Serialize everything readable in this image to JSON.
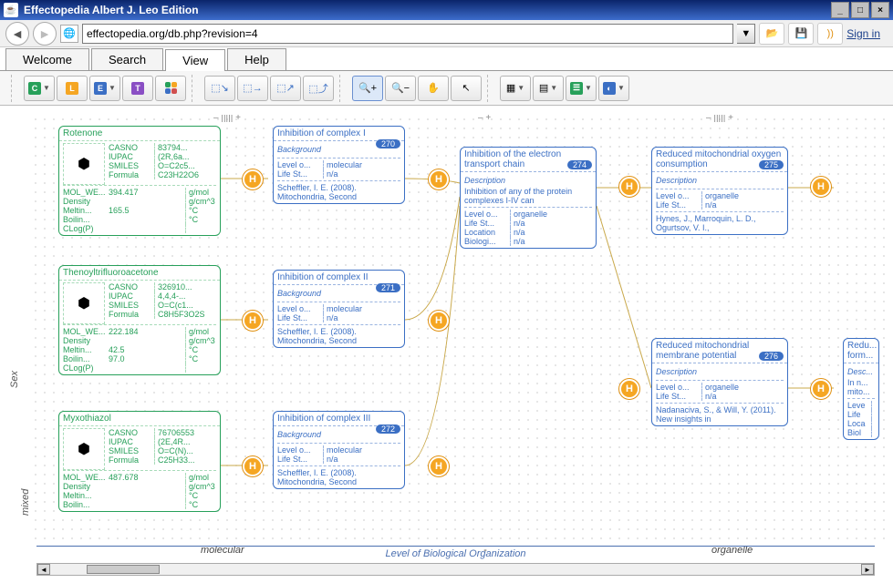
{
  "window": {
    "title": "Effectopedia  Albert J. Leo Edition"
  },
  "addressbar": {
    "url": "effectopedia.org/db.php?revision=4",
    "sign_in": "Sign in"
  },
  "tabs": {
    "welcome": "Welcome",
    "search": "Search",
    "view": "View",
    "help": "Help"
  },
  "axes": {
    "y_label_1": "Sex",
    "y_label_2": "mixed",
    "x_label_1": "molecular",
    "x_label_2": "-",
    "x_label_3": "organelle",
    "x_title": "Level of Biological Organization"
  },
  "chemicals": [
    {
      "name": "Rotenone",
      "props": [
        [
          "CASNO",
          "83794..."
        ],
        [
          "IUPAC",
          "(2R,6a..."
        ],
        [
          "SMILES",
          "O=C2c5..."
        ],
        [
          "Formula",
          "C23H22O6"
        ]
      ],
      "phys": [
        [
          "MOL_WE...",
          "394.417",
          "g/mol"
        ],
        [
          "Density",
          "",
          "g/cm^3"
        ],
        [
          "Meltin...",
          "165.5",
          "°C"
        ],
        [
          "Boilin...",
          "",
          "°C"
        ],
        [
          "CLog(P)",
          "",
          ""
        ]
      ]
    },
    {
      "name": "Thenoyltrifluoroacetone",
      "props": [
        [
          "CASNO",
          "326910..."
        ],
        [
          "IUPAC",
          "4,4,4-..."
        ],
        [
          "SMILES",
          "O=C(c1..."
        ],
        [
          "Formula",
          "C8H5F3O2S"
        ]
      ],
      "phys": [
        [
          "MOL_WE...",
          "222.184",
          "g/mol"
        ],
        [
          "Density",
          "",
          "g/cm^3"
        ],
        [
          "Meltin...",
          "42.5",
          "°C"
        ],
        [
          "Boilin...",
          "97.0",
          "°C"
        ],
        [
          "CLog(P)",
          "",
          ""
        ]
      ]
    },
    {
      "name": "Myxothiazol",
      "props": [
        [
          "CASNO",
          "76706553"
        ],
        [
          "IUPAC",
          "(2E,4R..."
        ],
        [
          "SMILES",
          "O=C(N)..."
        ],
        [
          "Formula",
          "C25H33..."
        ]
      ],
      "phys": [
        [
          "MOL_WE...",
          "487.678",
          "g/mol"
        ],
        [
          "Density",
          "",
          "g/cm^3"
        ],
        [
          "Meltin...",
          "",
          "°C"
        ],
        [
          "Boilin...",
          "",
          "°C"
        ]
      ]
    }
  ],
  "events": [
    {
      "id": "270",
      "title": "Inhibition of complex I",
      "subtitle": "Background",
      "rows": [
        [
          "Level o...",
          "molecular"
        ],
        [
          "Life St...",
          "n/a"
        ]
      ],
      "ref": "Scheffler, I. E. (2008). Mitochondria, Second"
    },
    {
      "id": "271",
      "title": "Inhibition of complex II",
      "subtitle": "Background",
      "rows": [
        [
          "Level o...",
          "molecular"
        ],
        [
          "Life St...",
          "n/a"
        ]
      ],
      "ref": "Scheffler, I. E. (2008). Mitochondria, Second"
    },
    {
      "id": "272",
      "title": "Inhibition of complex III",
      "subtitle": "Background",
      "rows": [
        [
          "Level o...",
          "molecular"
        ],
        [
          "Life St...",
          "n/a"
        ]
      ],
      "ref": "Scheffler, I. E. (2008). Mitochondria, Second"
    },
    {
      "id": "274",
      "title": "Inhibition of the electron transport chain",
      "subtitle": "Description",
      "desc": "Inhibition of any of the protein complexes I-IV can",
      "rows": [
        [
          "Level o...",
          "organelle"
        ],
        [
          "Life St...",
          "n/a"
        ],
        [
          "Location",
          "n/a"
        ],
        [
          "Biologi...",
          "n/a"
        ]
      ]
    },
    {
      "id": "275",
      "title": "Reduced mitochondrial oxygen consumption",
      "subtitle": "Description",
      "rows": [
        [
          "Level o...",
          "organelle"
        ],
        [
          "Life St...",
          "n/a"
        ]
      ],
      "ref": "Hynes, J., Marroquin, L. D., Ogurtsov, V. I.,"
    },
    {
      "id": "276",
      "title": "Reduced mitochondrial membrane potential",
      "subtitle": "Description",
      "rows": [
        [
          "Level o...",
          "organelle"
        ],
        [
          "Life St...",
          "n/a"
        ]
      ],
      "ref": "Nadanaciva, S., & Will, Y. (2011). New insights in"
    },
    {
      "id": "extra",
      "title": "Redu... form...",
      "subtitle": "Desc...",
      "desc": "In n... mito...",
      "rows": [
        [
          "Leve",
          ""
        ],
        [
          "Life",
          ""
        ],
        [
          "Loca",
          ""
        ],
        [
          "Biol",
          ""
        ]
      ]
    }
  ],
  "linker_label": "H",
  "dividers": {
    "left": "– ||||| +",
    "mid": "–  +",
    "right": "– ||||| +"
  }
}
